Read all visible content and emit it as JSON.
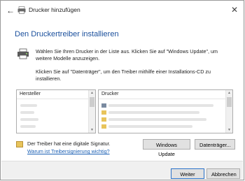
{
  "window": {
    "title": "Drucker hinzufügen",
    "back_icon": "back-arrow-icon",
    "close_glyph": "✕"
  },
  "main": {
    "heading": "Den Druckertreiber installieren",
    "description1": "Wählen Sie Ihren Drucker in der Liste aus. Klicken Sie auf \"Windows Update\", um weitere Modelle anzuzeigen.",
    "description2": "Klicken Sie auf \"Datenträger\", um den Treiber mithilfe einer Installations-CD zu installieren."
  },
  "lists": {
    "manufacturer_header": "Hersteller",
    "printer_header": "Drucker"
  },
  "signature": {
    "text": "Der Treiber hat eine digitale Signatur.",
    "link": "Warum ist Treibersignierung wichtig?"
  },
  "buttons": {
    "windows_update": "Windows Update",
    "have_disk": "Datenträger...",
    "next": "Weiter",
    "cancel": "Abbrechen"
  },
  "colors": {
    "heading": "#1a4f9c",
    "link": "#1a5fb4",
    "primary_border": "#2b72c9"
  }
}
